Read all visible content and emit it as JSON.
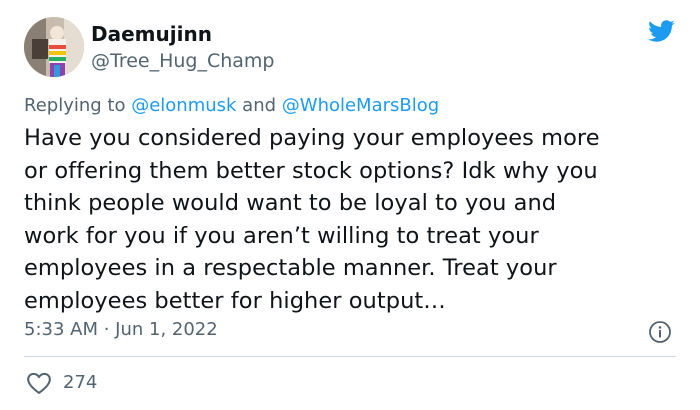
{
  "author": {
    "display_name": "Daemujinn",
    "handle": "@Tree_Hug_Champ"
  },
  "reply": {
    "prefix": "Replying to ",
    "mention_1": "@elonmusk",
    "joiner": " and ",
    "mention_2": "@WholeMarsBlog"
  },
  "tweet": {
    "lines": [
      "Have you considered paying your employees more",
      "or offering them better stock options? Idk why you",
      "think people would want to be loyal to you and",
      "work for you if you aren’t willing to treat your",
      "employees in a respectable manner. Treat your",
      "employees better for higher output…"
    ],
    "timestamp": "5:33 AM · Jun 1, 2022"
  },
  "engagement": {
    "like_count": "274"
  },
  "icons": {
    "brand": "twitter-bird-icon",
    "info": "info-icon",
    "like": "heart-icon"
  },
  "colors": {
    "brand_blue": "#1d9bf0",
    "text": "#0f1419",
    "secondary": "#536471",
    "divider": "#cfd9de"
  }
}
